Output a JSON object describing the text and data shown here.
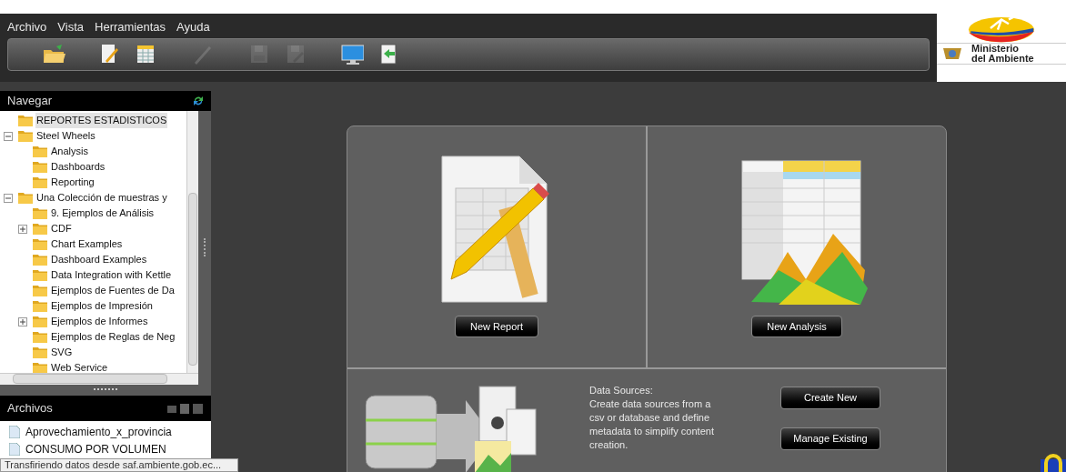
{
  "menu": [
    "Archivo",
    "Vista",
    "Herramientas",
    "Ayuda"
  ],
  "toolbar": [
    {
      "kind": "open",
      "disabled": false
    },
    {
      "kind": "report",
      "disabled": false
    },
    {
      "kind": "analysis",
      "disabled": false
    },
    {
      "kind": "edit",
      "disabled": true
    },
    {
      "kind": "save",
      "disabled": true
    },
    {
      "kind": "saveas",
      "disabled": true
    },
    {
      "kind": "monitor",
      "disabled": false
    },
    {
      "kind": "import",
      "disabled": false
    }
  ],
  "logo": {
    "line_1": "Ministerio",
    "line_2": "del Ambiente"
  },
  "navigate": {
    "title": "Navegar",
    "tree": [
      {
        "label": "REPORTES ESTADISTICOS",
        "selected": true
      },
      {
        "label": "Steel Wheels",
        "selected": false,
        "expanded": true,
        "children": [
          {
            "label": "Analysis",
            "selected": false
          },
          {
            "label": "Dashboards",
            "selected": false
          },
          {
            "label": "Reporting",
            "selected": false
          }
        ]
      },
      {
        "label": "Una Colección de muestras y",
        "selected": false,
        "expanded": true,
        "children": [
          {
            "label": "9. Ejemplos de Análisis",
            "selected": false
          },
          {
            "label": "CDF",
            "selected": false,
            "expanded": false
          },
          {
            "label": "Chart Examples",
            "selected": false
          },
          {
            "label": "Dashboard Examples",
            "selected": false
          },
          {
            "label": "Data Integration with Kettle",
            "selected": false
          },
          {
            "label": "Ejemplos de Fuentes de Da",
            "selected": false
          },
          {
            "label": "Ejemplos de Impresión",
            "selected": false
          },
          {
            "label": "Ejemplos de Informes",
            "selected": false,
            "expanded": false
          },
          {
            "label": "Ejemplos de Reglas de Neg",
            "selected": false
          },
          {
            "label": "SVG",
            "selected": false
          },
          {
            "label": "Web Service",
            "selected": false
          }
        ]
      }
    ]
  },
  "files": {
    "title": "Archivos",
    "items": [
      "Aprovechamiento_x_provincia",
      "CONSUMO POR VOLUMEN"
    ]
  },
  "status_bar": "Transfiriendo datos desde saf.ambiente.gob.ec...",
  "launch": {
    "new_report": "New Report",
    "new_analysis": "New Analysis",
    "data_sources": {
      "title": "Data Sources:",
      "description": "Create data sources from a csv or database and define metadata to simplify content creation.",
      "buttons": [
        "Create New",
        "Manage Existing"
      ]
    }
  }
}
